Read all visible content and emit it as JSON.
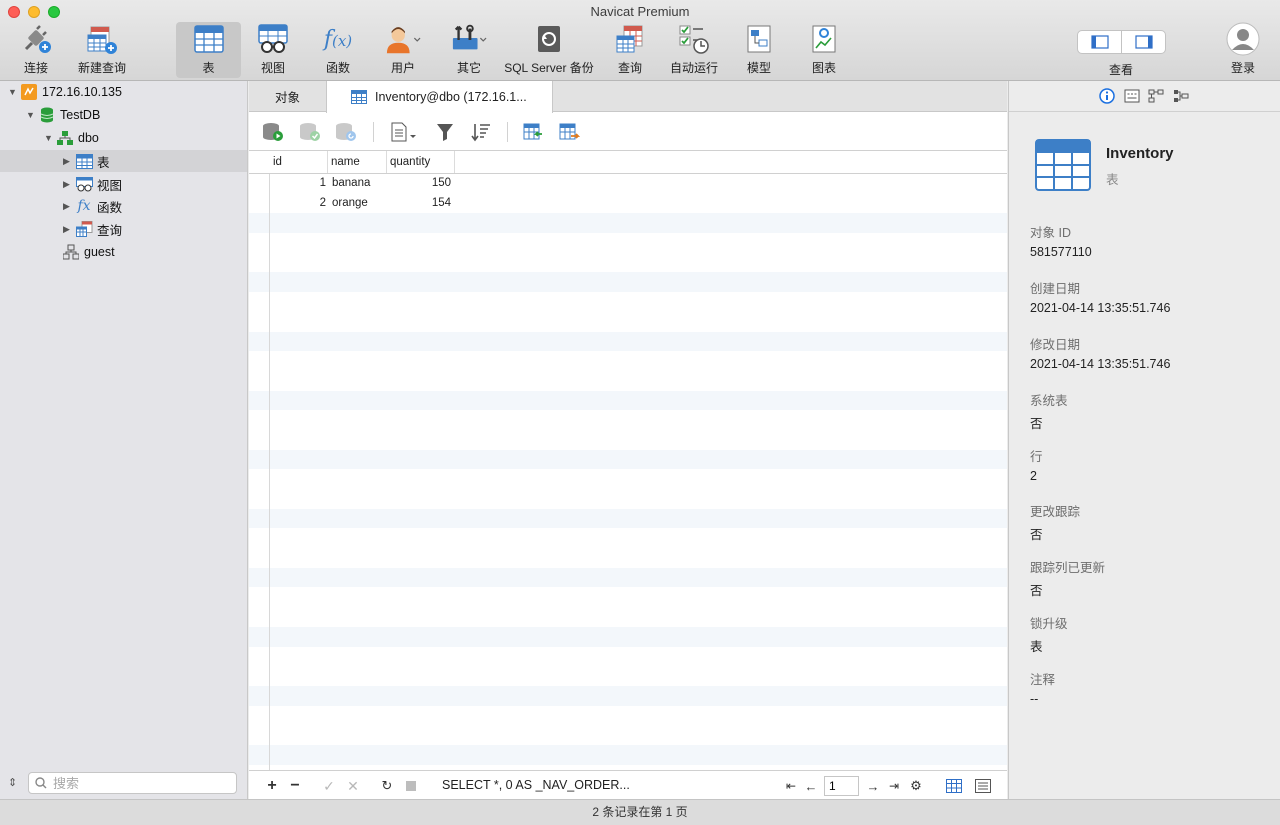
{
  "window": {
    "title": "Navicat Premium"
  },
  "toolbar": {
    "connect": "连接",
    "new_query": "新建查询",
    "table": "表",
    "view": "视图",
    "function": "函数",
    "user": "用户",
    "other": "其它",
    "backup": "SQL Server 备份",
    "query": "查询",
    "automation": "自动运行",
    "model": "模型",
    "chart": "图表",
    "view_mode": "查看",
    "login": "登录"
  },
  "sidebar": {
    "server": "172.16.10.135",
    "database": "TestDB",
    "schema": "dbo",
    "items": [
      {
        "label": "表"
      },
      {
        "label": "视图"
      },
      {
        "label": "函数"
      },
      {
        "label": "查询"
      }
    ],
    "guest": "guest",
    "search_placeholder": "搜索"
  },
  "tabs": {
    "objects": "对象",
    "inventory": "Inventory@dbo (172.16.1..."
  },
  "grid": {
    "columns": [
      "id",
      "name",
      "quantity"
    ],
    "rows": [
      {
        "id": "1",
        "name": "banana",
        "quantity": "150"
      },
      {
        "id": "2",
        "name": "orange",
        "quantity": "154"
      }
    ]
  },
  "bottom": {
    "sql": "SELECT *, 0 AS _NAV_ORDER...",
    "page": "1"
  },
  "info": {
    "name": "Inventory",
    "type": "表",
    "props": [
      {
        "key": "对象 ID",
        "value": "581577110"
      },
      {
        "key": "创建日期",
        "value": "2021-04-14 13:35:51.746"
      },
      {
        "key": "修改日期",
        "value": "2021-04-14 13:35:51.746"
      },
      {
        "key": "系统表",
        "value": "否"
      },
      {
        "key": "行",
        "value": "2"
      },
      {
        "key": "更改跟踪",
        "value": "否"
      },
      {
        "key": "跟踪列已更新",
        "value": "否"
      },
      {
        "key": "锁升级",
        "value": "表"
      },
      {
        "key": "注释",
        "value": "--"
      }
    ]
  },
  "status": {
    "text": "2 条记录在第 1 页"
  },
  "colors": {
    "close": "#fe5f57",
    "minimize": "#febc2e",
    "zoom": "#28c840",
    "table_blue": "#3d7fc7",
    "info_blue": "#1a6fe0"
  }
}
